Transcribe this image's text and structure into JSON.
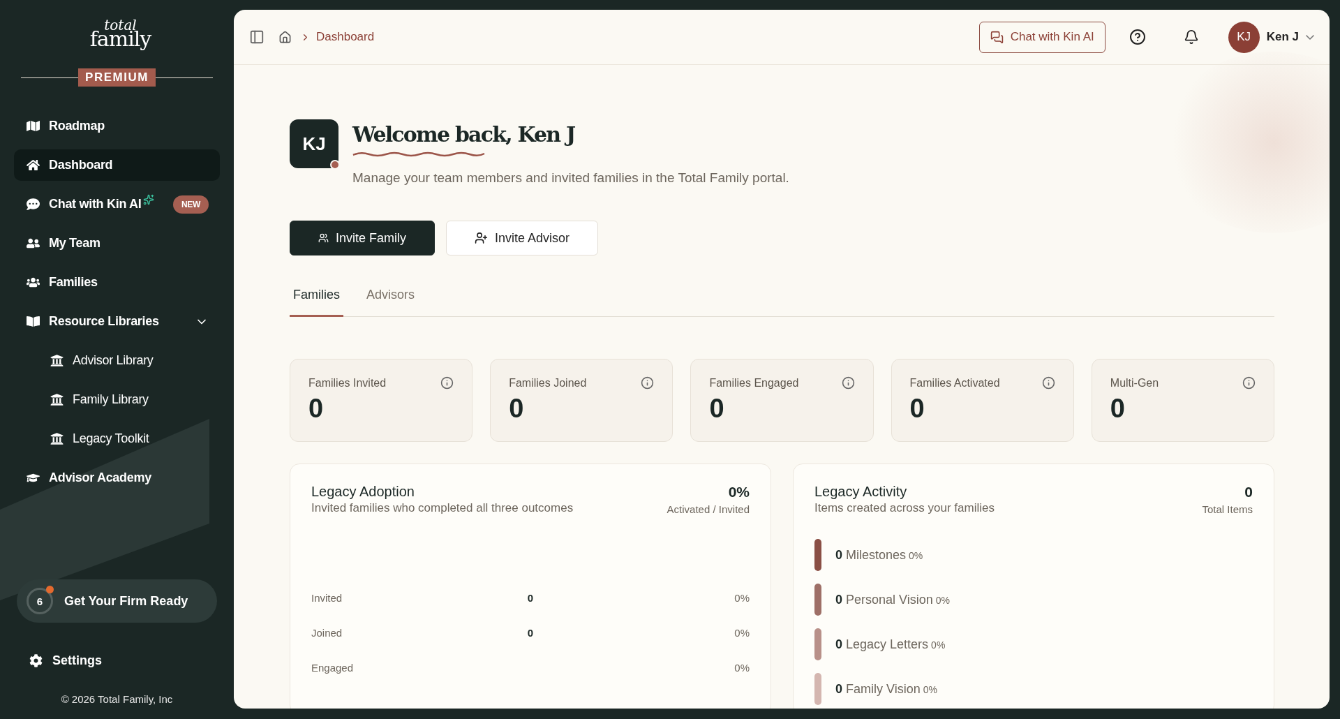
{
  "sidebar": {
    "logo": {
      "line1": "total",
      "line2": "family"
    },
    "plan_badge": "PREMIUM",
    "items": [
      {
        "kind": "item",
        "label": "Roadmap",
        "selected": false
      },
      {
        "kind": "item",
        "label": "Dashboard",
        "selected": true
      },
      {
        "kind": "item",
        "label": "Chat with Kin AI",
        "selected": false,
        "sparkle": true,
        "badge": "NEW"
      },
      {
        "kind": "item",
        "label": "My Team",
        "selected": false
      },
      {
        "kind": "item",
        "label": "Families",
        "selected": false
      },
      {
        "kind": "group",
        "label": "Resource Libraries",
        "selected": false,
        "expanded": true,
        "children": [
          {
            "label": "Advisor Library",
            "selected": false
          },
          {
            "label": "Family Library",
            "selected": false
          },
          {
            "label": "Legacy Toolkit",
            "selected": false
          }
        ]
      },
      {
        "kind": "item",
        "label": "Advisor Academy",
        "selected": false
      }
    ],
    "firm_ready": {
      "count": "6",
      "label": "Get Your Firm Ready"
    },
    "settings": "Settings",
    "copyright": "© 2026 Total Family, Inc"
  },
  "header": {
    "breadcrumb": [
      "Dashboard"
    ],
    "chat_button": "Chat with Kin AI",
    "user": {
      "initials": "KJ",
      "name": "Ken J"
    }
  },
  "welcome": {
    "initials": "KJ",
    "title": "Welcome back, Ken J",
    "subtitle": "Manage your team members and invited families in the Total Family portal."
  },
  "actions": [
    {
      "kind": "primary",
      "label": "Invite Family"
    },
    {
      "kind": "secondary",
      "label": "Invite Advisor"
    }
  ],
  "tabs": [
    {
      "label": "Families",
      "selected": true
    },
    {
      "label": "Advisors",
      "selected": false
    }
  ],
  "stats": [
    {
      "label": "Families Invited",
      "value": "0"
    },
    {
      "label": "Families Joined",
      "value": "0"
    },
    {
      "label": "Families Engaged",
      "value": "0"
    },
    {
      "label": "Families Activated",
      "value": "0"
    },
    {
      "label": "Multi-Gen",
      "value": "0"
    }
  ],
  "adoption": {
    "title": "Legacy Adoption",
    "subtitle": "Invited families who completed all three outcomes",
    "value": "0%",
    "caption": "Activated / Invited",
    "rows": [
      {
        "label": "Invited",
        "count": "0",
        "percent": "0%"
      },
      {
        "label": "Joined",
        "count": "0",
        "percent": "0%"
      },
      {
        "label": "Engaged",
        "percent": "0%"
      }
    ]
  },
  "activity": {
    "title": "Legacy Activity",
    "subtitle": "Items created across your families",
    "value": "0",
    "caption": "Total Items",
    "items": [
      {
        "count": "0",
        "label": "Milestones",
        "percent": "0%",
        "color": "#8a4f45"
      },
      {
        "count": "0",
        "label": "Personal Vision",
        "percent": "0%",
        "color": "#9e6f67"
      },
      {
        "count": "0",
        "label": "Legacy Letters",
        "percent": "0%",
        "color": "#b89089"
      },
      {
        "count": "0",
        "label": "Family Vision",
        "percent": "0%",
        "color": "#d4b6b0"
      }
    ]
  }
}
